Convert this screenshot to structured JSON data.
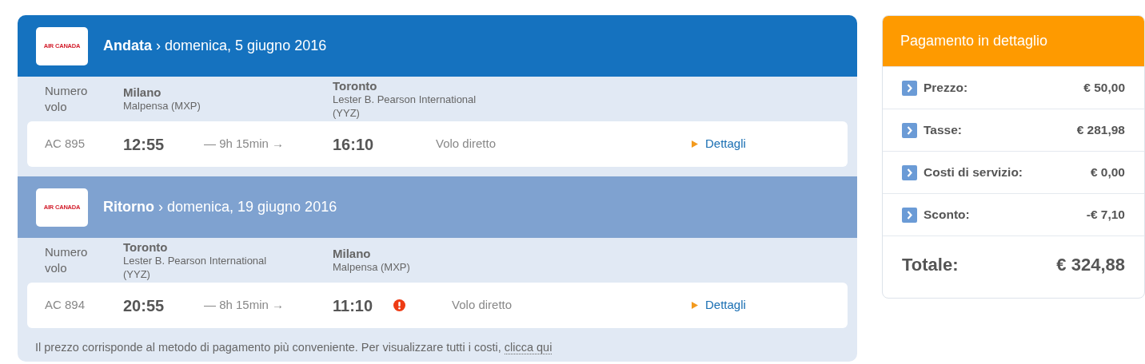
{
  "legs": [
    {
      "kind": "outbound",
      "airline_logo": "AIR CANADA",
      "direction": "Andata",
      "date": "› domenica, 5 giugno 2016",
      "number_label": "Numero volo",
      "from": {
        "city": "Milano",
        "airport": "Malpensa (MXP)"
      },
      "to": {
        "city": "Toronto",
        "airport": "Lester B. Pearson International (YYZ)"
      },
      "flight": {
        "number": "AC 895",
        "departure": "12:55",
        "duration": "— 9h 15min →",
        "arrival": "16:10",
        "warning": false,
        "type": "Volo diretto",
        "details": "Dettagli"
      }
    },
    {
      "kind": "return",
      "airline_logo": "AIR CANADA",
      "direction": "Ritorno",
      "date": "› domenica, 19 giugno 2016",
      "number_label": "Numero volo",
      "from": {
        "city": "Toronto",
        "airport": "Lester B. Pearson International (YYZ)"
      },
      "to": {
        "city": "Milano",
        "airport": "Malpensa (MXP)"
      },
      "flight": {
        "number": "AC 894",
        "departure": "20:55",
        "duration": "— 8h 15min →",
        "arrival": "11:10",
        "warning": true,
        "type": "Volo diretto",
        "details": "Dettagli"
      }
    }
  ],
  "footnote": {
    "text": "Il prezzo corrisponde al metodo di pagamento più conveniente. Per visualizzare tutti i costi,",
    "link": "clicca qui"
  },
  "payment": {
    "title": "Pagamento in dettaglio",
    "rows": [
      {
        "label": "Prezzo:",
        "value": "€ 50,00"
      },
      {
        "label": "Tasse:",
        "value": "€ 281,98"
      },
      {
        "label": "Costi di servizio:",
        "value": "€ 0,00"
      },
      {
        "label": "Sconto:",
        "value": "-€ 7,10"
      }
    ],
    "total_label": "Totale:",
    "total_value": "€ 324,88"
  }
}
